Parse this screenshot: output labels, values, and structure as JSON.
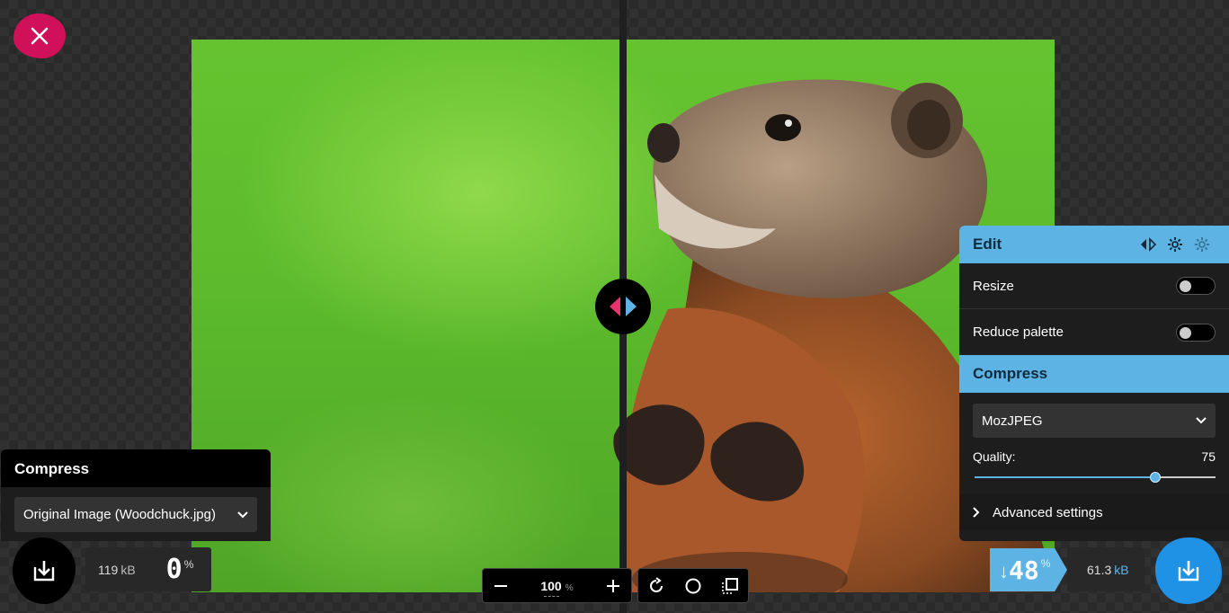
{
  "close": {
    "icon": "close-icon",
    "color": "#d1105a"
  },
  "left_panel": {
    "title": "Compress",
    "select_value": "Original Image (Woodchuck.jpg)"
  },
  "left_result": {
    "size": "119",
    "size_unit": "kB",
    "percent": "0",
    "percent_sym": "%"
  },
  "toolbar": {
    "zoom": "100",
    "zoom_unit": "%"
  },
  "right_panel": {
    "edit_title": "Edit",
    "resize_label": "Resize",
    "resize_on": false,
    "palette_label": "Reduce palette",
    "palette_on": false,
    "compress_title": "Compress",
    "codec": "MozJPEG",
    "quality_label": "Quality:",
    "quality_value": "75",
    "quality_fraction": 0.75,
    "advanced_label": "Advanced settings",
    "accent": "#5cb3e4"
  },
  "right_result": {
    "arrow": "↓",
    "percent": "48",
    "percent_sym": "%",
    "size": "61.3",
    "size_unit": "kB",
    "color": "#1f92e6"
  }
}
